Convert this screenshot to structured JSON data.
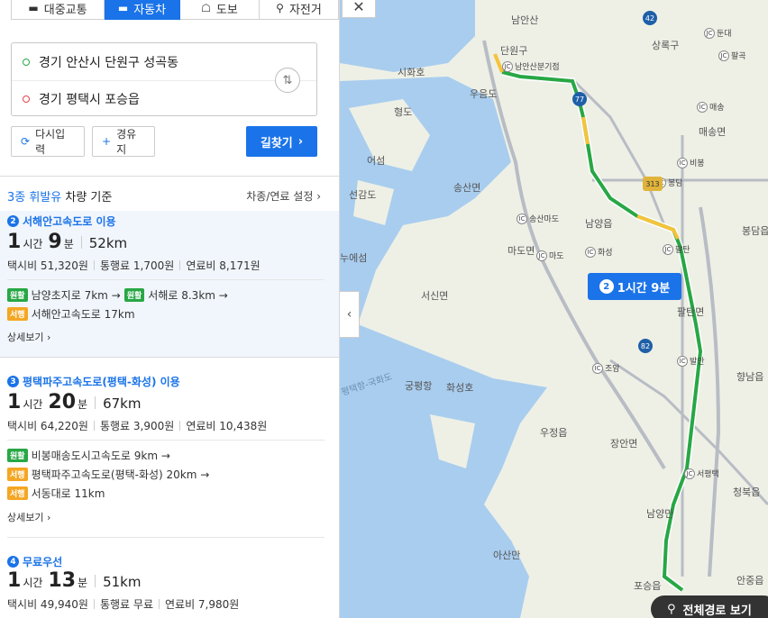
{
  "modes": [
    {
      "label": "대중교통",
      "icon": "bus-icon"
    },
    {
      "label": "자동차",
      "icon": "car-icon",
      "active": true
    },
    {
      "label": "도보",
      "icon": "walk-icon"
    },
    {
      "label": "자전거",
      "icon": "bike-icon"
    }
  ],
  "origin": "경기 안산시 단원구 성곡동",
  "destination": "경기 평택시 포승읍",
  "buttons": {
    "reset": "다시입력",
    "waypoint": "경유지",
    "search": "길찾기"
  },
  "vehicle": {
    "prefix": "3종 휘발유",
    "suffix": " 차량 기준",
    "settings": "차종/연료 설정"
  },
  "routes": [
    {
      "num": "2",
      "title": "서해안고속도로 이용",
      "hours": "1",
      "hours_unit": "시간",
      "mins": "9",
      "mins_unit": "분",
      "dist": "52km",
      "taxi": "택시비 51,320원",
      "toll": "통행료 1,700원",
      "fuel": "연료비 8,171원",
      "segments": [
        {
          "tag": "원활",
          "color": "g",
          "text": "남양초지로 7km →",
          "tag2": "원활",
          "text2": "서해로 8.3km →"
        },
        {
          "tag": "서행",
          "color": "y",
          "text": "서해안고속도로 17km"
        }
      ],
      "detail": "상세보기"
    },
    {
      "num": "3",
      "title": "평택파주고속도로(평택-화성) 이용",
      "hours": "1",
      "hours_unit": "시간",
      "mins": "20",
      "mins_unit": "분",
      "dist": "67km",
      "taxi": "택시비 64,220원",
      "toll": "통행료 3,900원",
      "fuel": "연료비 10,438원",
      "segments": [
        {
          "tag": "원활",
          "color": "g",
          "text": "비봉매송도시고속도로 9km →"
        },
        {
          "tag": "서행",
          "color": "y",
          "text": "평택파주고속도로(평택-화성) 20km →"
        },
        {
          "tag": "서행",
          "color": "y",
          "text": "서동대로 11km"
        }
      ],
      "detail": "상세보기"
    },
    {
      "num": "4",
      "title": "무료우선",
      "hours": "1",
      "hours_unit": "시간",
      "mins": "13",
      "mins_unit": "분",
      "dist": "51km",
      "taxi": "택시비 49,940원",
      "toll": "통행료 무료",
      "fuel": "연료비 7,980원"
    }
  ],
  "map": {
    "start_label": "출발",
    "end_label": "도착",
    "bubble": {
      "num": "2",
      "text": "1시간 9분"
    },
    "full_route": "전체경로 보기",
    "labels": [
      "남안산",
      "단원구",
      "남안산분기점",
      "시화호",
      "우음도",
      "형도",
      "어섬",
      "송산면",
      "선감도",
      "마도면",
      "남양읍",
      "서신면",
      "누에섬",
      "평택항-국화도",
      "궁평항",
      "화성호",
      "우정읍",
      "장안면",
      "아산만",
      "포승읍",
      "팔탄면",
      "향남읍",
      "청북읍",
      "매송면",
      "봉담읍",
      "상록구",
      "안중읍",
      "송산마도",
      "마도",
      "화성",
      "팔탄",
      "조암",
      "발안",
      "서평택",
      "남양만",
      "비봉",
      "매송",
      "팔곡",
      "둔대",
      "봉담",
      "42",
      "77",
      "313",
      "82",
      "입도"
    ]
  }
}
